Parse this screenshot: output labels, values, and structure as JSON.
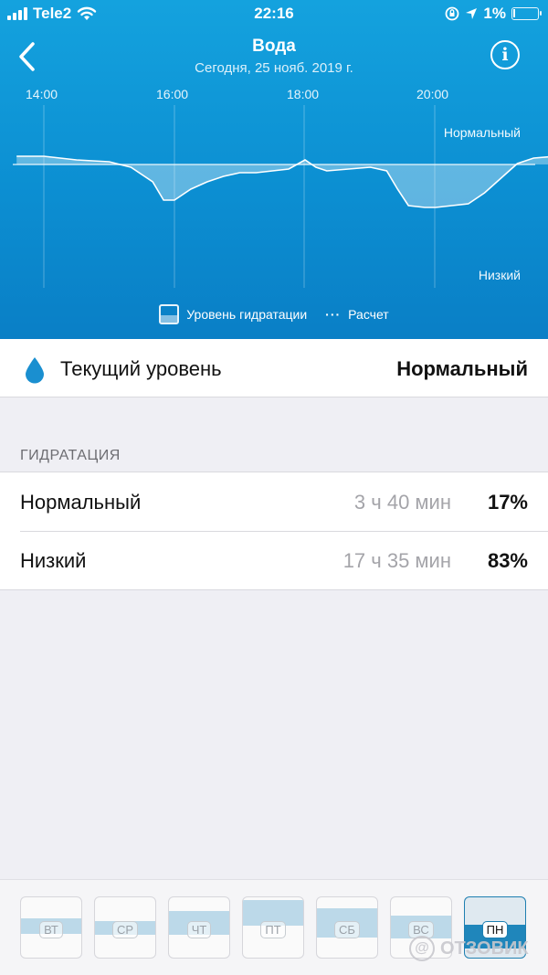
{
  "status_bar": {
    "carrier": "Tele2",
    "time": "22:16",
    "battery": "1%"
  },
  "nav": {
    "title": "Вода",
    "subtitle": "Сегодня, 25 нояб. 2019 г."
  },
  "chart_data": {
    "type": "area",
    "x_ticks": [
      "14:00",
      "16:00",
      "18:00",
      "20:00"
    ],
    "level_labels": {
      "high": "Нормальный",
      "low": "Низкий"
    },
    "series": [
      {
        "x": [
          "13:35",
          "14:00",
          "14:30",
          "15:00",
          "15:20",
          "15:40",
          "15:50",
          "16:00",
          "16:15",
          "16:30",
          "16:45",
          "17:00",
          "17:15",
          "17:30",
          "17:45",
          "18:00",
          "18:10",
          "18:20",
          "18:40",
          "19:00",
          "19:15",
          "19:25",
          "19:35",
          "19:50",
          "20:00",
          "20:15",
          "20:30",
          "20:45",
          "21:00",
          "21:15",
          "21:30",
          "21:50"
        ],
        "values": [
          0.72,
          0.72,
          0.7,
          0.69,
          0.66,
          0.58,
          0.48,
          0.48,
          0.54,
          0.58,
          0.61,
          0.63,
          0.63,
          0.64,
          0.65,
          0.7,
          0.66,
          0.64,
          0.65,
          0.66,
          0.64,
          0.54,
          0.45,
          0.44,
          0.44,
          0.45,
          0.46,
          0.52,
          0.6,
          0.68,
          0.71,
          0.72
        ]
      }
    ],
    "legend": [
      "Уровень гидратации",
      "Расчет"
    ]
  },
  "current": {
    "label": "Текущий уровень",
    "value": "Нормальный"
  },
  "section": {
    "title": "ГИДРАТАЦИЯ"
  },
  "rows": [
    {
      "name": "Нормальный",
      "duration": "3 ч 40 мин",
      "percent": "17%"
    },
    {
      "name": "Низкий",
      "duration": "17 ч 35 мин",
      "percent": "83%"
    }
  ],
  "days": [
    {
      "label": "ВТ",
      "band_top": 0.35,
      "band_h": 0.25,
      "low": false
    },
    {
      "label": "СР",
      "band_top": 0.4,
      "band_h": 0.22,
      "low": false
    },
    {
      "label": "ЧТ",
      "band_top": 0.22,
      "band_h": 0.4,
      "low": false
    },
    {
      "label": "ПТ",
      "band_top": 0.05,
      "band_h": 0.42,
      "low": false
    },
    {
      "label": "СБ",
      "band_top": 0.18,
      "band_h": 0.48,
      "low": false
    },
    {
      "label": "ВС",
      "band_top": 0.3,
      "band_h": 0.38,
      "low": false
    },
    {
      "label": "ПН",
      "band_top": 0.45,
      "band_h": 0.4,
      "low": false,
      "active": true
    }
  ],
  "watermark": "ОТЗОВИК"
}
